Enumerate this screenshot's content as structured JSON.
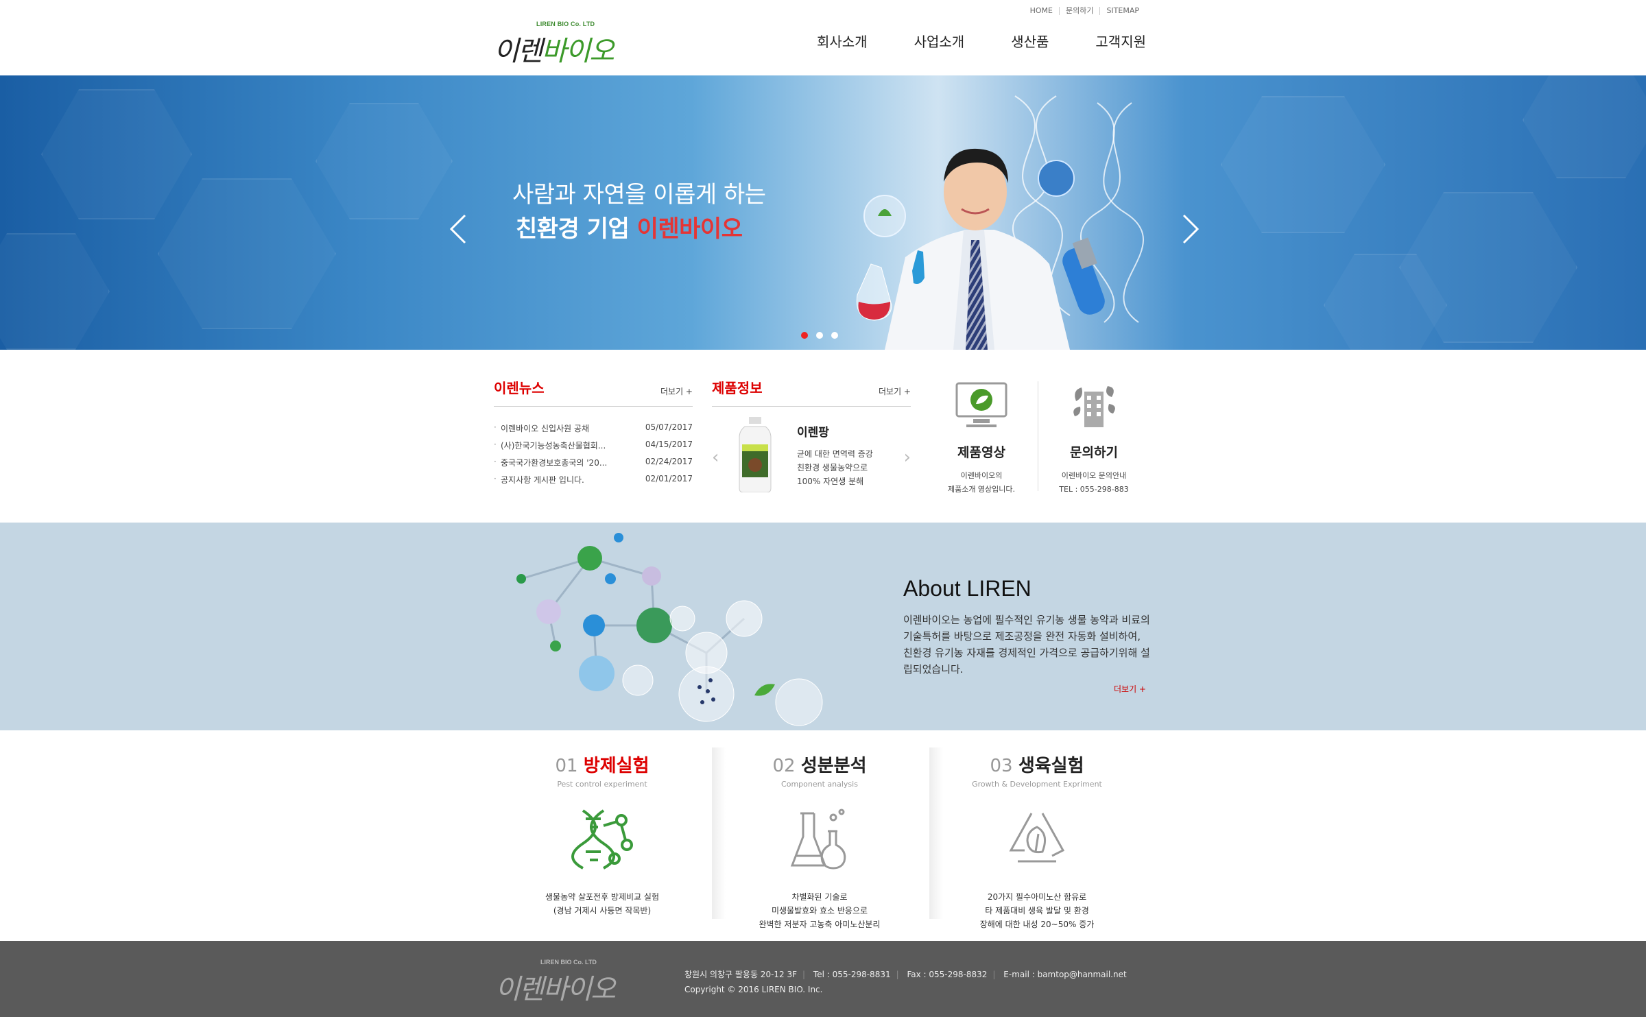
{
  "header": {
    "logo_sub": "LIREN BIO Co. LTD",
    "logo_main_a": "이렌",
    "logo_main_b": "바이오",
    "util": [
      "HOME",
      "문의하기",
      "SITEMAP"
    ],
    "nav": [
      "회사소개",
      "사업소개",
      "생산품",
      "고객지원"
    ]
  },
  "hero": {
    "line1": "사람과 자연을 이롭게 하는",
    "line2_a": "친환경 기업 ",
    "line2_b": "이렌바이오",
    "prev_icon": "chevron-left-icon",
    "next_icon": "chevron-right-icon",
    "active_slide": 1,
    "slide_count": 3
  },
  "news": {
    "title": "이렌뉴스",
    "more": "더보기 +",
    "items": [
      {
        "title": "이렌바이오 신입사원 공채",
        "date": "05/07/2017"
      },
      {
        "title": "(사)한국기능성농축산물협회...",
        "date": "04/15/2017"
      },
      {
        "title": "중국국가환경보호총국의 '20...",
        "date": "02/24/2017"
      },
      {
        "title": "공지사항 게시판 입니다.",
        "date": "02/01/2017"
      }
    ]
  },
  "product": {
    "title": "제품정보",
    "more": "더보기 +",
    "name": "이렌팡",
    "desc": [
      "균에 대한 면역력 증강",
      "친환경 생물농약으로",
      "100% 자연생 분해"
    ],
    "prev": "‹",
    "next": "›"
  },
  "quick": [
    {
      "title": "제품영상",
      "desc": [
        "이렌바이오의",
        "제품소개 영상입니다."
      ],
      "icon": "monitor-leaf-icon"
    },
    {
      "title": "문의하기",
      "desc": [
        "이렌바이오 문의안내",
        "TEL : 055-298-883"
      ],
      "icon": "building-leaf-icon"
    }
  ],
  "about": {
    "heading": "About LIREN",
    "body": "이렌바이오는 농업에 필수적인 유기농 생물 농약과 비료의 기술특허를 바탕으로 제조공정을 완전 자동화 설비하여, 친환경 유기농 자재를 경제적인 가격으로 공급하기위해 설립되었습니다.",
    "more": "더보기 +"
  },
  "services": [
    {
      "num": "01",
      "title": "방제실험",
      "en": "Pest control experiment",
      "desc": [
        "생물농약 살포전후 방제비교 실험",
        "(경남 거제시 사등면 작목반)"
      ],
      "icon": "dna-icon"
    },
    {
      "num": "02",
      "title": "성분분석",
      "en": "Component analysis",
      "desc": [
        "차별화된 기술로",
        "미생물발효와 효소 반응으로",
        "완벽한 저분자 고농축 아미노산분리"
      ],
      "icon": "flask-icon"
    },
    {
      "num": "03",
      "title": "생육실험",
      "en": "Growth & Development Expriment",
      "desc": [
        "20가지 필수아미노산 함유로",
        "타 제품대비 생육 발달 및 환경",
        "장해에 대한 내성 20~50% 증가"
      ],
      "icon": "recycle-leaf-icon"
    }
  ],
  "footer": {
    "logo_sub": "LIREN BIO Co. LTD",
    "logo_main": "이렌바이오",
    "address": "창원시 의창구 팔용동 20-12 3F",
    "tel": "Tel : 055-298-8831",
    "fax": "Fax : 055-298-8832",
    "email": "E-mail : bamtop@hanmail.net",
    "copyright": "Copyright © 2016 LIREN BIO. Inc."
  },
  "colors": {
    "accent": "#dd0000",
    "green": "#3c9a2a",
    "footer": "#5a5a5a",
    "about_bg": "#c4d6e3"
  }
}
